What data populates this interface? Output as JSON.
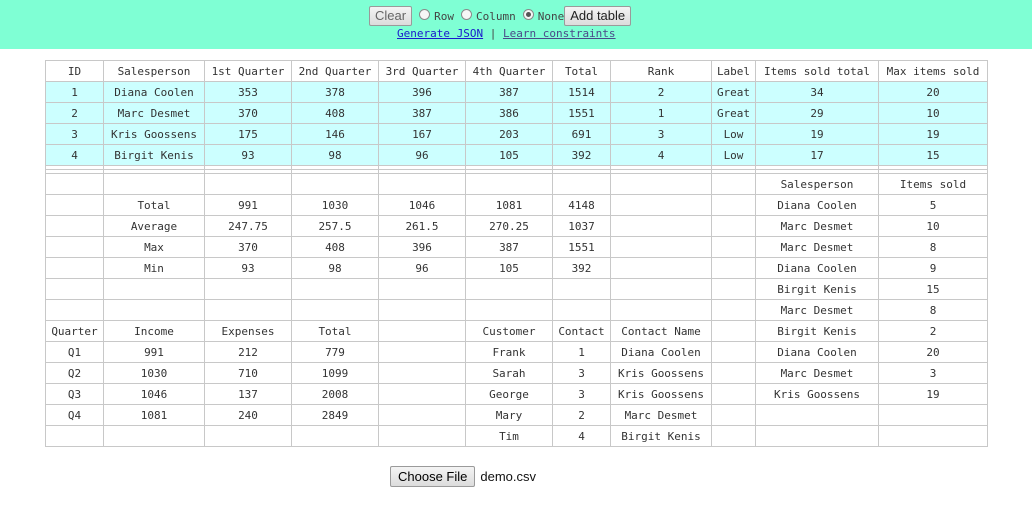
{
  "toolbar": {
    "clear_label": "Clear",
    "radio_row": "Row",
    "radio_column": "Column",
    "radio_none": "None",
    "selected": "None",
    "add_table_label": "Add table"
  },
  "links": {
    "generate_json": "Generate JSON",
    "separator": "|",
    "learn_constraints": "Learn constraints"
  },
  "grid": {
    "rows": [
      [
        "ID",
        "Salesperson",
        "1st Quarter",
        "2nd Quarter",
        "3rd Quarter",
        "4th Quarter",
        "Total",
        "Rank",
        "Label",
        "Items sold total",
        "Max items sold"
      ],
      [
        "1",
        "Diana Coolen",
        "353",
        "378",
        "396",
        "387",
        "1514",
        "2",
        "Great",
        "34",
        "20"
      ],
      [
        "2",
        "Marc Desmet",
        "370",
        "408",
        "387",
        "386",
        "1551",
        "1",
        "Great",
        "29",
        "10"
      ],
      [
        "3",
        "Kris Goossens",
        "175",
        "146",
        "167",
        "203",
        "691",
        "3",
        "Low",
        "19",
        "19"
      ],
      [
        "4",
        "Birgit Kenis",
        "93",
        "98",
        "96",
        "105",
        "392",
        "4",
        "Low",
        "17",
        "15"
      ],
      [
        "",
        "",
        "",
        "",
        "",
        "",
        "",
        "",
        "",
        "",
        ""
      ],
      [
        "",
        "",
        "",
        "",
        "",
        "",
        "",
        "",
        "",
        "",
        ""
      ],
      [
        "",
        "",
        "",
        "",
        "",
        "",
        "",
        "",
        "",
        "Salesperson",
        "Items sold"
      ],
      [
        "",
        "Total",
        "991",
        "1030",
        "1046",
        "1081",
        "4148",
        "",
        "",
        "Diana Coolen",
        "5"
      ],
      [
        "",
        "Average",
        "247.75",
        "257.5",
        "261.5",
        "270.25",
        "1037",
        "",
        "",
        "Marc Desmet",
        "10"
      ],
      [
        "",
        "Max",
        "370",
        "408",
        "396",
        "387",
        "1551",
        "",
        "",
        "Marc Desmet",
        "8"
      ],
      [
        "",
        "Min",
        "93",
        "98",
        "96",
        "105",
        "392",
        "",
        "",
        "Diana Coolen",
        "9"
      ],
      [
        "",
        "",
        "",
        "",
        "",
        "",
        "",
        "",
        "",
        "Birgit Kenis",
        "15"
      ],
      [
        "",
        "",
        "",
        "",
        "",
        "",
        "",
        "",
        "",
        "Marc Desmet",
        "8"
      ],
      [
        "Quarter",
        "Income",
        "Expenses",
        "Total",
        "",
        "Customer",
        "Contact",
        "Contact Name",
        "",
        "Birgit Kenis",
        "2"
      ],
      [
        "Q1",
        "991",
        "212",
        "779",
        "",
        "Frank",
        "1",
        "Diana Coolen",
        "",
        "Diana Coolen",
        "20"
      ],
      [
        "Q2",
        "1030",
        "710",
        "1099",
        "",
        "Sarah",
        "3",
        "Kris Goossens",
        "",
        "Marc Desmet",
        "3"
      ],
      [
        "Q3",
        "1046",
        "137",
        "2008",
        "",
        "George",
        "3",
        "Kris Goossens",
        "",
        "Kris Goossens",
        "19"
      ],
      [
        "Q4",
        "1081",
        "240",
        "2849",
        "",
        "Mary",
        "2",
        "Marc Desmet",
        "",
        "",
        ""
      ],
      [
        "",
        "",
        "",
        "",
        "",
        "Tim",
        "4",
        "Birgit Kenis",
        "",
        "",
        ""
      ]
    ],
    "highlight_color": "#ccffff"
  },
  "file": {
    "button_label": "Choose File",
    "filename": "demo.csv"
  },
  "colors": {
    "topbar": "#7fffd4",
    "link": "#1a1acc"
  }
}
